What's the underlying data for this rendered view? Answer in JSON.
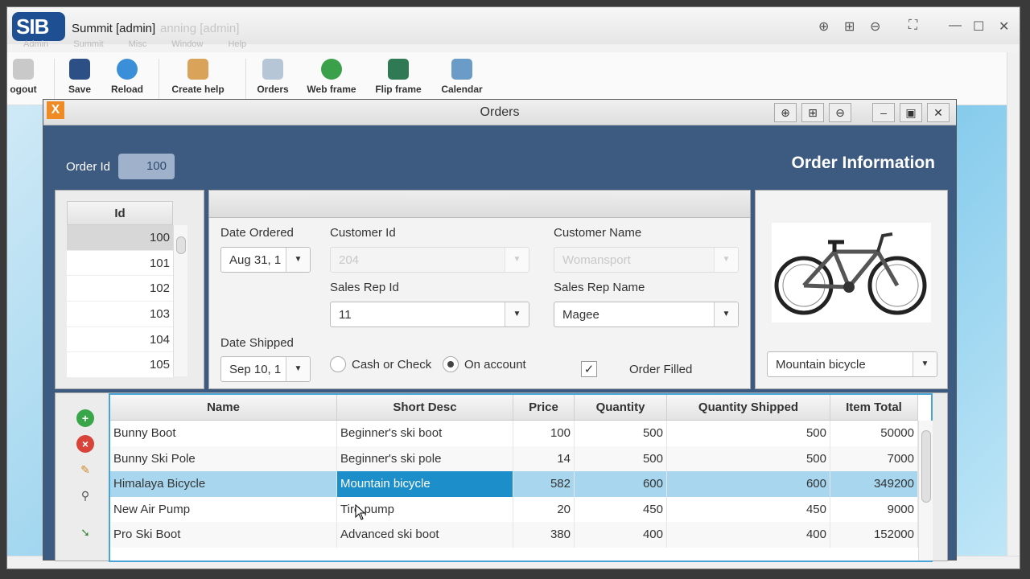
{
  "app": {
    "title": "Summit [admin]",
    "ghost_title": "anning [admin]",
    "logo": "SIB",
    "menu": [
      "Admin",
      "Summit",
      "Misc",
      "Window",
      "Help"
    ],
    "window_controls": [
      "zoom-in-icon",
      "fit-icon",
      "zoom-out-icon",
      "fullscreen-icon",
      "minimize-icon",
      "maximize-icon",
      "close-icon"
    ]
  },
  "toolbar": {
    "buttons": [
      {
        "label": "ogout",
        "icon": "logout-icon"
      },
      {
        "label": "Save",
        "icon": "save-icon"
      },
      {
        "label": "Reload",
        "icon": "reload-icon"
      },
      {
        "label": "Create help",
        "icon": "create-help-icon"
      },
      {
        "label": "Orders",
        "icon": "orders-icon"
      },
      {
        "label": "Web frame",
        "icon": "globe-icon"
      },
      {
        "label": "Flip frame",
        "icon": "flip-frame-icon"
      },
      {
        "label": "Calendar",
        "icon": "calendar-icon"
      }
    ]
  },
  "orders": {
    "title": "Orders",
    "order_id_label": "Order Id",
    "order_id_value": "100",
    "header": "Order Information",
    "id_table": {
      "column": "Id",
      "rows": [
        "100",
        "101",
        "102",
        "103",
        "104",
        "105"
      ],
      "selected": "100"
    },
    "form": {
      "date_ordered_label": "Date Ordered",
      "date_ordered_value": "Aug 31, 1",
      "customer_id_label": "Customer Id",
      "customer_id_value": "204",
      "customer_name_label": "Customer Name",
      "customer_name_value": "Womansport",
      "sales_rep_id_label": "Sales Rep Id",
      "sales_rep_id_value": "11",
      "sales_rep_name_label": "Sales Rep Name",
      "sales_rep_name_value": "Magee",
      "date_shipped_label": "Date Shipped",
      "date_shipped_value": "Sep 10, 1",
      "payment_option_1": "Cash or Check",
      "payment_option_2": "On account",
      "payment_selected": "On account",
      "order_filled_label": "Order Filled",
      "order_filled_checked": true
    },
    "product_select_value": "Mountain bicycle",
    "items": {
      "columns": [
        "Name",
        "Short Desc",
        "Price",
        "Quantity",
        "Quantity Shipped",
        "Item Total"
      ],
      "rows": [
        [
          "Bunny Boot",
          "Beginner's ski boot",
          "100",
          "500",
          "500",
          "50000"
        ],
        [
          "Bunny Ski Pole",
          "Beginner's ski pole",
          "14",
          "500",
          "500",
          "7000"
        ],
        [
          "Himalaya Bicycle",
          "Mountain bicycle",
          "582",
          "600",
          "600",
          "349200"
        ],
        [
          "New Air Pump",
          "Tire pump",
          "20",
          "450",
          "450",
          "9000"
        ],
        [
          "Pro Ski Boot",
          "Advanced ski boot",
          "380",
          "400",
          "400",
          "152000"
        ]
      ],
      "selected_row": 2,
      "side_actions": [
        "add-icon",
        "delete-icon",
        "edit-icon",
        "search-icon",
        "export-icon"
      ]
    }
  },
  "colors": {
    "frame_background": "#3d5a80",
    "selection": "#a7d6ee",
    "focus_cell": "#1c8fca",
    "grid_border": "#4aa3d8"
  }
}
